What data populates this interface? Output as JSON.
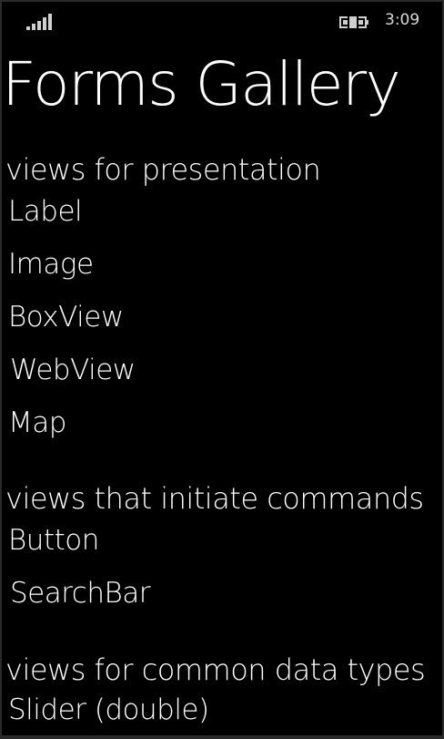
{
  "status_bar": {
    "time": "3:09",
    "signal_icon": "signal-strength-icon",
    "battery_icon": "battery-charging-icon"
  },
  "title": "Forms Gallery",
  "groups": [
    {
      "header": "views for presentation",
      "items": [
        "Label",
        "Image",
        "BoxView",
        "WebView",
        "Map"
      ]
    },
    {
      "header": "views that initiate commands",
      "items": [
        "Button",
        "SearchBar"
      ]
    },
    {
      "header": "views for common data types",
      "items": [
        "Slider (double)"
      ]
    }
  ]
}
